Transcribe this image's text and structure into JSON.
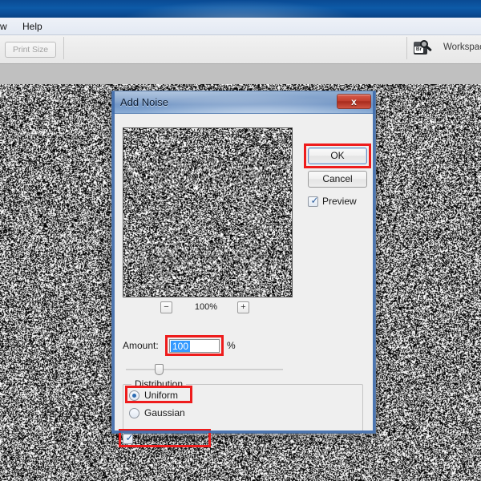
{
  "app": {
    "menu": {
      "partial_item": "w",
      "items": [
        "Help"
      ]
    },
    "options_bar": {
      "print_size_label": "Print Size",
      "bridge_icon_label": "Br",
      "workspace_label": "Workspac"
    }
  },
  "dialog": {
    "title": "Add Noise",
    "close_glyph": "x",
    "buttons": {
      "ok": "OK",
      "cancel": "Cancel"
    },
    "preview_checkbox": {
      "label": "Preview",
      "checked": true,
      "tick": "✓"
    },
    "zoom": {
      "minus": "−",
      "percent": "100%",
      "plus": "+"
    },
    "amount": {
      "label": "Amount:",
      "value": "100",
      "unit": "%",
      "selected": true,
      "slider_position_pct": 21
    },
    "distribution": {
      "legend": "Distribution",
      "options": [
        {
          "label": "Uniform",
          "selected": true
        },
        {
          "label": "Gaussian",
          "selected": false
        }
      ]
    },
    "monochromatic": {
      "label": "Monochromatic",
      "checked": true,
      "tick": "✓"
    },
    "highlights": {
      "color": "#ee1c1c",
      "targets": [
        "ok-button",
        "amount-input",
        "uniform-radio",
        "monochromatic-checkbox"
      ]
    }
  },
  "colors": {
    "window_title_blue": "#0d5aa7",
    "dialog_frame_blue": "#3e6aaa",
    "dialog_bg": "#efefef",
    "close_button_red": "#c23f2f",
    "selection_blue": "#3399ff",
    "highlight_red": "#ee1c1c"
  }
}
